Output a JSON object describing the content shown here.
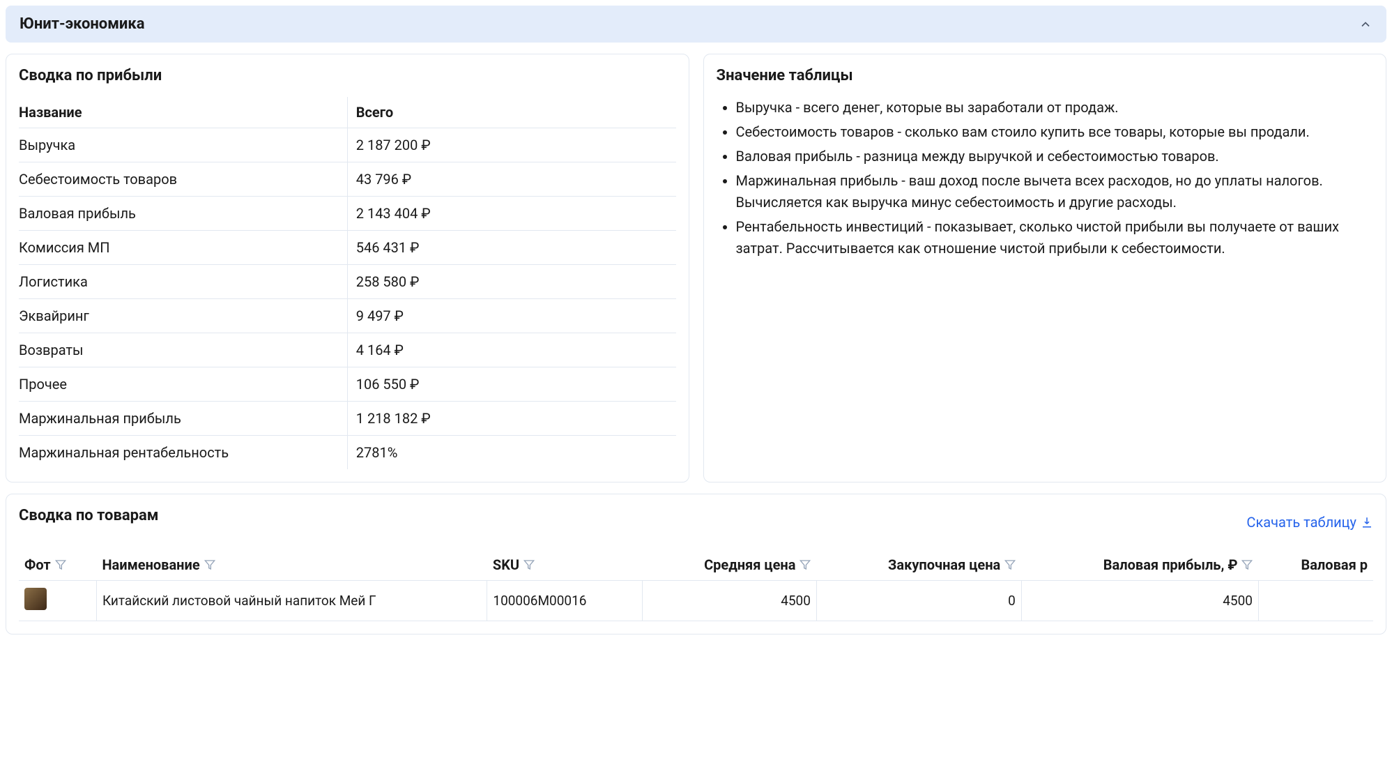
{
  "header": {
    "title": "Юнит-экономика"
  },
  "profit_summary": {
    "title": "Сводка по прибыли",
    "columns": {
      "name": "Название",
      "total": "Всего"
    },
    "rows": [
      {
        "name": "Выручка",
        "total": "2 187 200 ₽"
      },
      {
        "name": "Себестоимость товаров",
        "total": "43 796 ₽"
      },
      {
        "name": "Валовая прибыль",
        "total": "2 143 404 ₽"
      },
      {
        "name": "Комиссия МП",
        "total": "546 431 ₽"
      },
      {
        "name": "Логистика",
        "total": "258 580 ₽"
      },
      {
        "name": "Эквайринг",
        "total": "9 497 ₽"
      },
      {
        "name": "Возвраты",
        "total": "4 164 ₽"
      },
      {
        "name": "Прочее",
        "total": "106 550 ₽"
      },
      {
        "name": "Маржинальная прибыль",
        "total": "1 218 182 ₽"
      },
      {
        "name": "Маржинальная рентабельность",
        "total": "2781%"
      }
    ]
  },
  "descriptions": {
    "title": "Значение таблицы",
    "items": [
      "Выручка - всего денег, которые вы заработали от продаж.",
      "Себестоимость товаров - сколько вам стоило купить все товары, которые вы продали.",
      "Валовая прибыль - разница между выручкой и себестоимостью товаров.",
      "Маржинальная прибыль - ваш доход после вычета всех расходов, но до уплаты налогов. Вычисляется как выручка минус себестоимость и другие расходы.",
      "Рентабельность инвестиций - показывает, сколько чистой прибыли вы получаете от ваших затрат. Рассчитывается как отношение чистой прибыли к себестоимости."
    ]
  },
  "products_summary": {
    "title": "Сводка по товарам",
    "download_label": "Скачать таблицу",
    "columns": {
      "photo": "Фот",
      "name": "Наименование",
      "sku": "SKU",
      "avg_price": "Средняя цена",
      "purchase_price": "Закупочная цена",
      "gross_profit_rub": "Валовая прибыль, ₽",
      "gross_profit_pct": "Валовая р"
    },
    "rows": [
      {
        "name": "Китайский листовой чайный напиток Мей Г",
        "sku": "100006M00016",
        "avg_price": "4500",
        "purchase_price": "0",
        "gross_profit_rub": "4500"
      }
    ]
  }
}
